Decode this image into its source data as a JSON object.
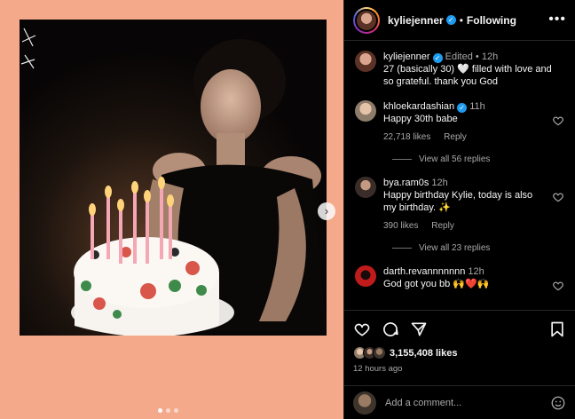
{
  "header": {
    "username": "kyliejenner",
    "separator": "•",
    "follow_label": "Following",
    "more_label": "•••"
  },
  "caption": {
    "username": "kyliejenner",
    "edited": "Edited",
    "dot": "•",
    "time": "12h",
    "text": "27 (basically 30) 🤍 filled with love and so grateful. thank you God"
  },
  "comments": [
    {
      "username": "khloekardashian",
      "verified": true,
      "time": "11h",
      "text": "Happy 30th babe",
      "likes": "22,718 likes",
      "reply_label": "Reply",
      "view_replies": "View all 56 replies"
    },
    {
      "username": "bya.ram0s",
      "verified": false,
      "time": "12h",
      "text": "Happy birthday Kylie, today is also my birthday. ✨",
      "likes": "390 likes",
      "reply_label": "Reply",
      "view_replies": "View all 23 replies"
    },
    {
      "username": "darth.revannnnnnn",
      "verified": false,
      "time": "12h",
      "text": "God got you bb 🙌❤️🙌",
      "likes": "",
      "reply_label": "",
      "view_replies": ""
    }
  ],
  "actions": {
    "icons": [
      "heart-icon",
      "comment-icon",
      "share-icon",
      "bookmark-icon"
    ]
  },
  "likes": {
    "count": "3,155,408 likes"
  },
  "post_time": "12 hours ago",
  "add_comment": {
    "placeholder": "Add a comment..."
  },
  "carousel": {
    "total": 3,
    "active": 0
  },
  "colors": {
    "background_peach": "#f4a98a",
    "verified_blue": "#1d9bf0",
    "panel_bg": "#000000",
    "muted_text": "#a8a8a8"
  }
}
